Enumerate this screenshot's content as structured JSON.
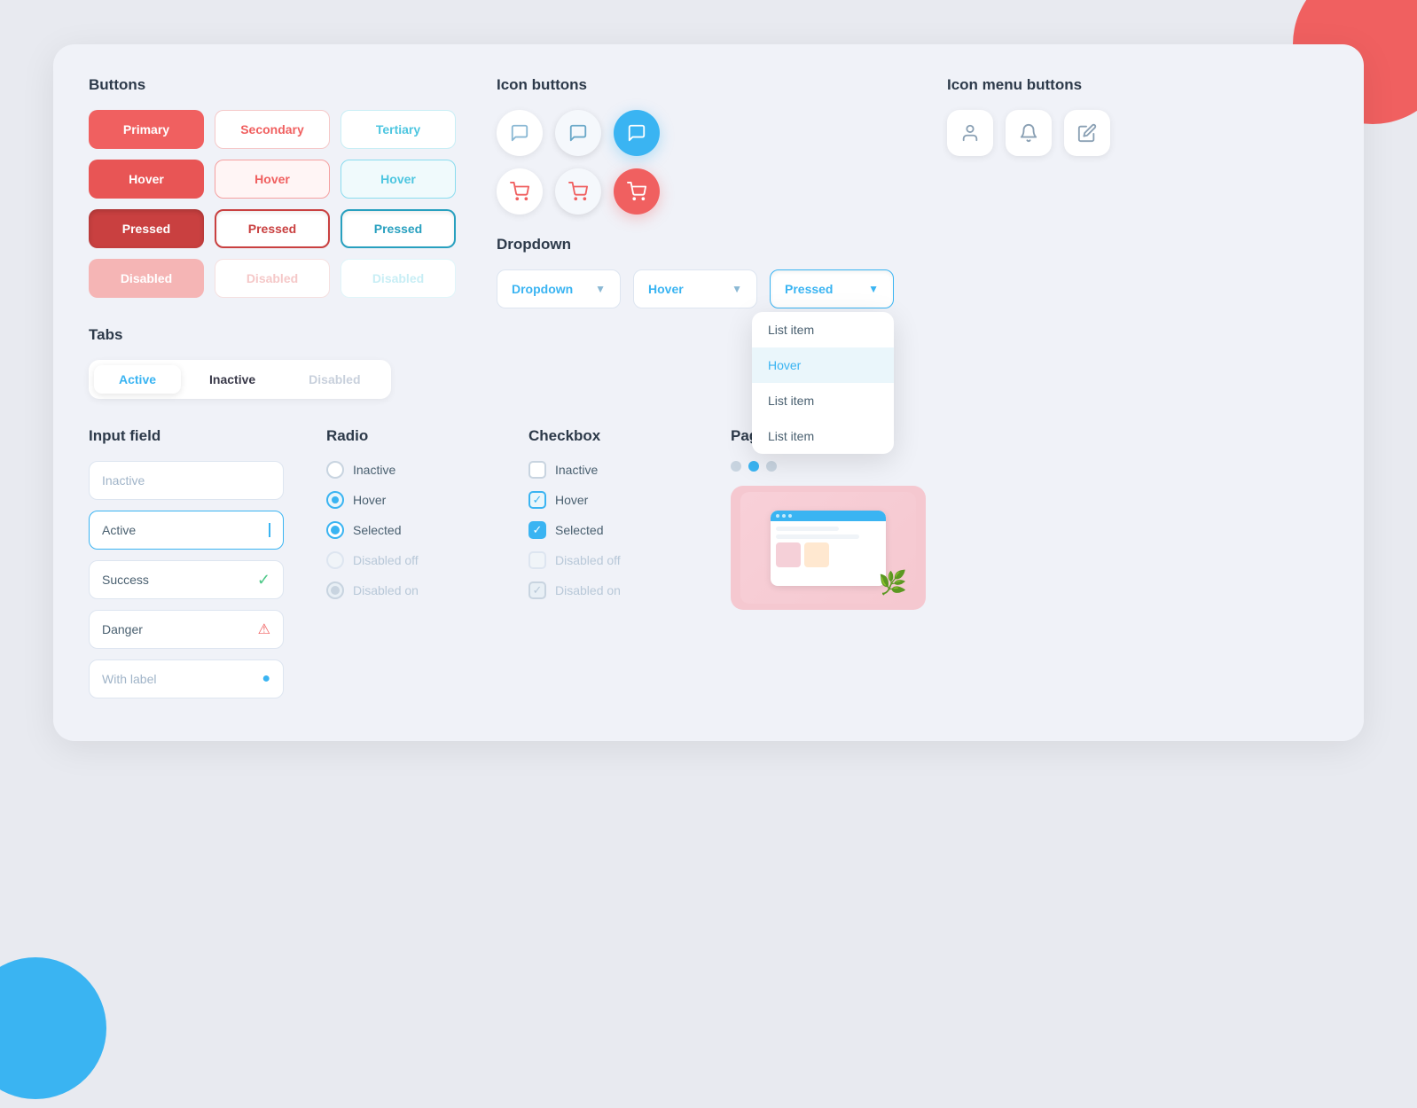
{
  "page": {
    "background": "#e8eaf0"
  },
  "buttons": {
    "title": "Buttons",
    "rows": [
      [
        "Primary",
        "Secondary",
        "Tertiary"
      ],
      [
        "Hover",
        "Hover",
        "Hover"
      ],
      [
        "Pressed",
        "Pressed",
        "Pressed"
      ],
      [
        "Disabled",
        "Disabled",
        "Disabled"
      ]
    ]
  },
  "icon_buttons": {
    "title": "Icon buttons"
  },
  "icon_menu_buttons": {
    "title": "Icon menu buttons"
  },
  "dropdown": {
    "title": "Dropdown",
    "items": [
      {
        "label": "Dropdown",
        "state": "default"
      },
      {
        "label": "Hover",
        "state": "hover"
      },
      {
        "label": "Pressed",
        "state": "pressed"
      }
    ],
    "menu_items": [
      "List item",
      "Hover",
      "List item",
      "List item"
    ]
  },
  "tabs": {
    "title": "Tabs",
    "items": [
      {
        "label": "Active",
        "state": "active"
      },
      {
        "label": "Inactive",
        "state": "inactive"
      },
      {
        "label": "Disabled",
        "state": "disabled"
      }
    ]
  },
  "input_field": {
    "title": "Input field",
    "items": [
      {
        "label": "Inactive",
        "state": "inactive"
      },
      {
        "label": "Active",
        "state": "active"
      },
      {
        "label": "Success",
        "state": "success"
      },
      {
        "label": "Danger",
        "state": "danger"
      },
      {
        "label": "With label",
        "state": "with_label"
      }
    ]
  },
  "radio": {
    "title": "Radio",
    "items": [
      {
        "label": "Inactive",
        "state": "inactive"
      },
      {
        "label": "Hover",
        "state": "hover"
      },
      {
        "label": "Selected",
        "state": "selected"
      },
      {
        "label": "Disabled off",
        "state": "disabled_off"
      },
      {
        "label": "Disabled on",
        "state": "disabled_on"
      }
    ]
  },
  "checkbox": {
    "title": "Checkbox",
    "items": [
      {
        "label": "Inactive",
        "state": "inactive"
      },
      {
        "label": "Hover",
        "state": "hover"
      },
      {
        "label": "Selected",
        "state": "selected"
      },
      {
        "label": "Disabled off",
        "state": "disabled_off"
      },
      {
        "label": "Disabled on",
        "state": "disabled_on"
      }
    ]
  },
  "pagination": {
    "title": "Pagination",
    "dots": [
      {
        "active": false
      },
      {
        "active": true
      },
      {
        "active": false
      }
    ]
  }
}
